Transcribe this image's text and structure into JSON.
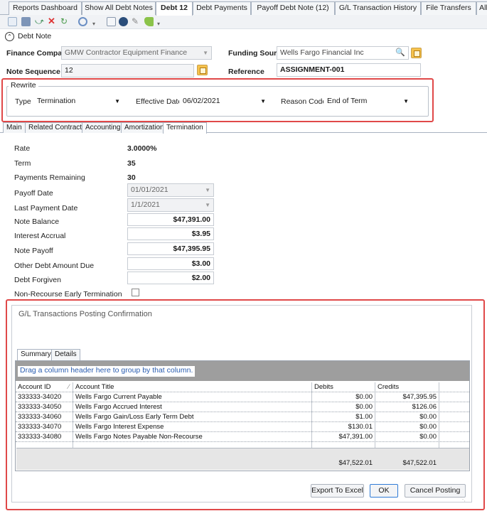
{
  "tabs": [
    {
      "label": "Reports Dashboard",
      "active": false
    },
    {
      "label": "Show All Debt Notes",
      "active": false
    },
    {
      "label": "Debt 12",
      "active": true
    },
    {
      "label": "Debt Payments",
      "active": false
    },
    {
      "label": "Payoff Debt Note (12)",
      "active": false
    },
    {
      "label": "G/L Transaction History",
      "active": false
    },
    {
      "label": "File Transfers",
      "active": false
    },
    {
      "label": "All",
      "active": false
    }
  ],
  "toolbar": {
    "icons": [
      "save-icon",
      "undo-icon",
      "delete-icon",
      "refresh-icon",
      "settings-icon",
      "list-icon",
      "globe-icon",
      "edit-icon",
      "tag-icon"
    ]
  },
  "section": {
    "title": "Debt Note"
  },
  "form": {
    "finance_company_label": "Finance Company",
    "finance_company_value": "GMW Contractor Equipment Finance",
    "funding_source_label": "Funding Source",
    "funding_source_value": "Wells Fargo Financial Inc",
    "note_sequence_label": "Note Sequence",
    "note_sequence_value": "12",
    "reference_label": "Reference",
    "reference_value": "ASSIGNMENT-001"
  },
  "rewrite": {
    "title": "Rewrite",
    "type_label": "Type",
    "type_value": "Termination",
    "effective_date_label": "Effective Date",
    "effective_date_value": "06/02/2021",
    "reason_code_label": "Reason Code",
    "reason_code_value": "End of Term"
  },
  "subtabs": [
    {
      "label": "Main",
      "active": false
    },
    {
      "label": "Related Contracts",
      "active": false
    },
    {
      "label": "Accounting",
      "active": false
    },
    {
      "label": "Amortization",
      "active": false
    },
    {
      "label": "Termination",
      "active": true
    }
  ],
  "termination": {
    "rate_label": "Rate",
    "rate_value": "3.0000%",
    "term_label": "Term",
    "term_value": "35",
    "payments_remaining_label": "Payments Remaining",
    "payments_remaining_value": "30",
    "payoff_date_label": "Payoff Date",
    "payoff_date_value": "01/01/2021",
    "last_payment_date_label": "Last Payment Date",
    "last_payment_date_value": "1/1/2021",
    "note_balance_label": "Note Balance",
    "note_balance_value": "$47,391.00",
    "interest_accrual_label": "Interest Accrual",
    "interest_accrual_value": "$3.95",
    "note_payoff_label": "Note Payoff",
    "note_payoff_value": "$47,395.95",
    "other_debt_label": "Other Debt Amount Due",
    "other_debt_value": "$3.00",
    "debt_forgiven_label": "Debt Forgiven",
    "debt_forgiven_value": "$2.00",
    "non_recourse_label": "Non-Recourse Early Termination"
  },
  "dialog": {
    "title": "G/L Transactions Posting Confirmation",
    "tabs": [
      {
        "label": "Summary",
        "active": true
      },
      {
        "label": "Details",
        "active": false
      }
    ],
    "group_hint": "Drag a column header here to group by that column.",
    "columns": [
      "Account ID",
      "Account Title",
      "Debits",
      "Credits"
    ],
    "rows": [
      [
        "333333-34020",
        "Wells Fargo Current Payable",
        "$0.00",
        "$47,395.95"
      ],
      [
        "333333-34050",
        "Wells Fargo Accrued Interest",
        "$0.00",
        "$126.06"
      ],
      [
        "333333-34060",
        "Wells Fargo Gain/Loss Early Term Debt",
        "$1.00",
        "$0.00"
      ],
      [
        "333333-34070",
        "Wells Fargo Interest Expense",
        "$130.01",
        "$0.00"
      ],
      [
        "333333-34080",
        "Wells Fargo Notes Payable Non-Recourse",
        "$47,391.00",
        "$0.00"
      ]
    ],
    "total_debits": "$47,522.01",
    "total_credits": "$47,522.01",
    "export_label": "Export To Excel",
    "ok_label": "OK",
    "cancel_label": "Cancel Posting"
  },
  "colors": {
    "highlight": "#e04848",
    "accent": "#2f7bd6",
    "toolbar_icon_gold": "#f6c24c"
  }
}
